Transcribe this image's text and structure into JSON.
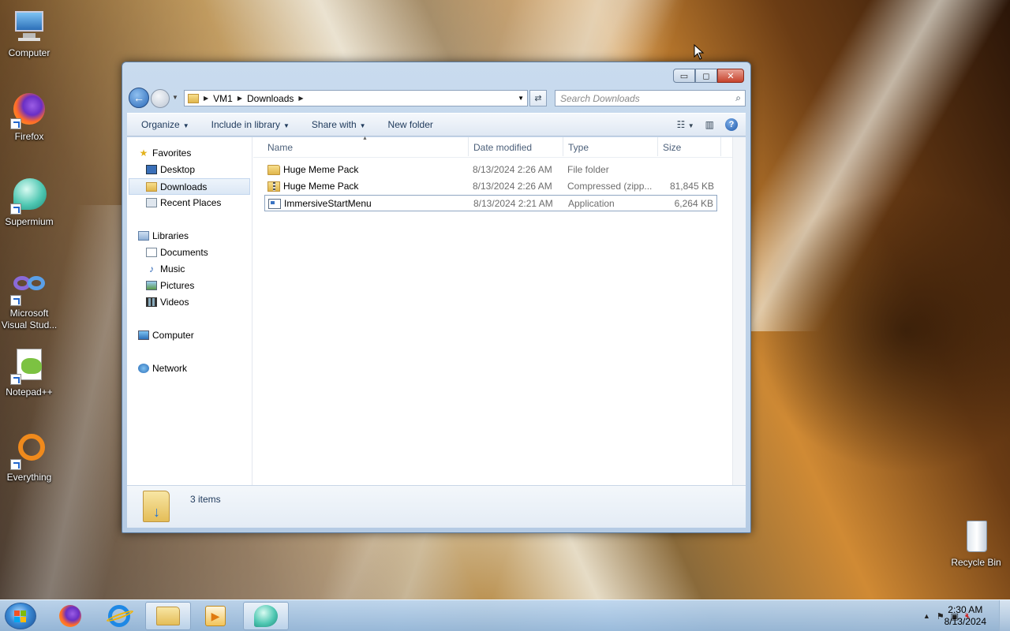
{
  "desktop": {
    "icons": [
      {
        "label": "Computer"
      },
      {
        "label": "Firefox"
      },
      {
        "label": "Supermium"
      },
      {
        "label": "Microsoft Visual Stud..."
      },
      {
        "label": "Notepad++"
      },
      {
        "label": "Everything"
      },
      {
        "label": "Recycle Bin"
      }
    ]
  },
  "window": {
    "controls": {
      "minimize": "▭",
      "maximize": "◻",
      "close": "✕"
    },
    "address": {
      "crumbs": [
        "VM1",
        "Downloads"
      ]
    },
    "search": {
      "placeholder": "Search Downloads"
    },
    "toolbar": {
      "organize": "Organize",
      "include_in_library": "Include in library",
      "share_with": "Share with",
      "new_folder": "New folder"
    },
    "nav": {
      "favorites": "Favorites",
      "desktop": "Desktop",
      "downloads": "Downloads",
      "recent_places": "Recent Places",
      "libraries": "Libraries",
      "documents": "Documents",
      "music": "Music",
      "pictures": "Pictures",
      "videos": "Videos",
      "computer": "Computer",
      "network": "Network"
    },
    "columns": {
      "name": "Name",
      "date": "Date modified",
      "type": "Type",
      "size": "Size"
    },
    "files": [
      {
        "name": "Huge Meme Pack",
        "date": "8/13/2024 2:26 AM",
        "type": "File folder",
        "size": "",
        "icon": "folder-icon"
      },
      {
        "name": "Huge Meme Pack",
        "date": "8/13/2024 2:26 AM",
        "type": "Compressed (zipp...",
        "size": "81,845 KB",
        "icon": "zip-folder-icon"
      },
      {
        "name": "ImmersiveStartMenu",
        "date": "8/13/2024 2:21 AM",
        "type": "Application",
        "size": "6,264 KB",
        "icon": "application-icon"
      }
    ],
    "details": {
      "count": "3 items"
    }
  },
  "taskbar": {
    "clock": {
      "time": "2:30 AM",
      "date": "8/13/2024"
    }
  }
}
